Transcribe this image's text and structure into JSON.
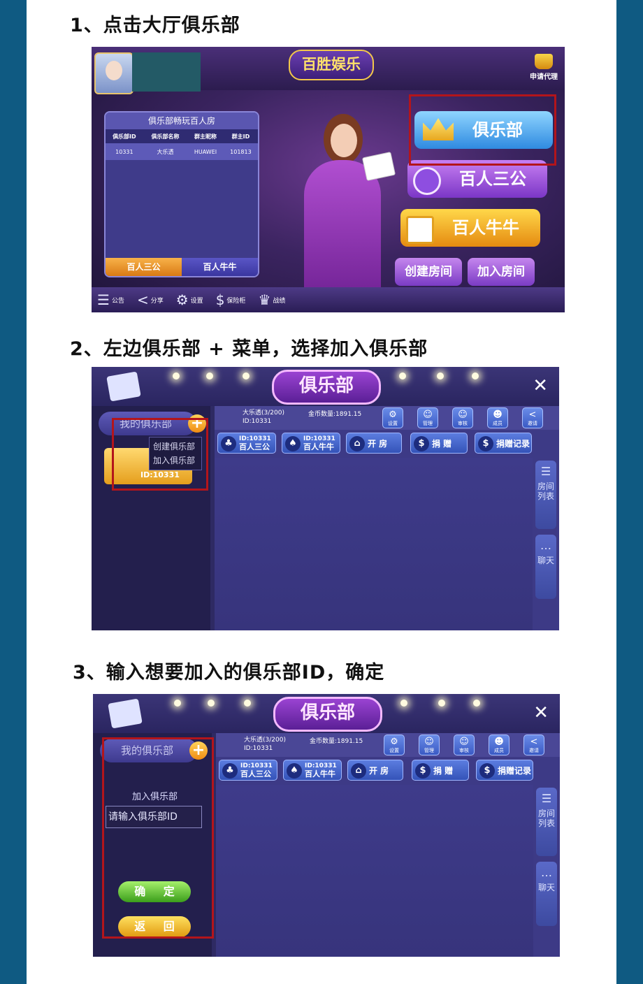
{
  "steps": [
    "1、点击大厅俱乐部",
    "2、左边俱乐部 + 菜单，选择加入俱乐部",
    "3、输入想要加入的俱乐部ID，确定"
  ],
  "lobby": {
    "logo": "百胜娱乐",
    "agent_label": "申请代理",
    "club_panel": {
      "title": "俱乐部畅玩百人房",
      "columns": [
        "俱乐部ID",
        "俱乐部名称",
        "群主昵称",
        "群主ID"
      ],
      "rows": [
        [
          "10331",
          "大乐透",
          "HUAWEI",
          "101813"
        ]
      ],
      "tabs": [
        "百人三公",
        "百人牛牛"
      ]
    },
    "buttons": {
      "club": "俱乐部",
      "sangong": "百人三公",
      "niuniu": "百人牛牛",
      "create_room": "创建房间",
      "join_room": "加入房间"
    },
    "bottom_bar": [
      {
        "icon": "notice-icon",
        "label": "公告"
      },
      {
        "icon": "share-icon",
        "label": "分享"
      },
      {
        "icon": "settings-icon",
        "label": "设置"
      },
      {
        "icon": "safe-icon",
        "label": "保险柜"
      },
      {
        "icon": "trophy-icon",
        "label": "战绩"
      }
    ]
  },
  "club_screen": {
    "title": "俱乐部",
    "close_glyph": "✕",
    "my_club": "我的俱乐部",
    "plus_glyph": "+",
    "club_name": "大乐透(3/200)",
    "club_id": "ID:10331",
    "gold": "金币数量:1891.15",
    "icon_buttons": [
      "设置",
      "管理",
      "审核",
      "成员",
      "邀请"
    ],
    "actions": {
      "sangong_id": "ID:10331",
      "sangong": "百人三公",
      "niuniu_id": "ID:10331",
      "niuniu": "百人牛牛",
      "open_room": "开 房",
      "donate": "捐 赠",
      "donate_log": "捐赠记录"
    },
    "side_tabs": {
      "room_list": "房间列表",
      "chat": "聊天"
    },
    "menu": {
      "create": "创建俱乐部",
      "join": "加入俱乐部"
    },
    "card_id": "ID:10331",
    "join_form": {
      "label": "加入俱乐部",
      "placeholder": "请输入俱乐部ID",
      "confirm": "确 定",
      "back": "返 回"
    }
  },
  "colors": {
    "frame": "#0f5a82",
    "highlight": "#b3151b"
  }
}
